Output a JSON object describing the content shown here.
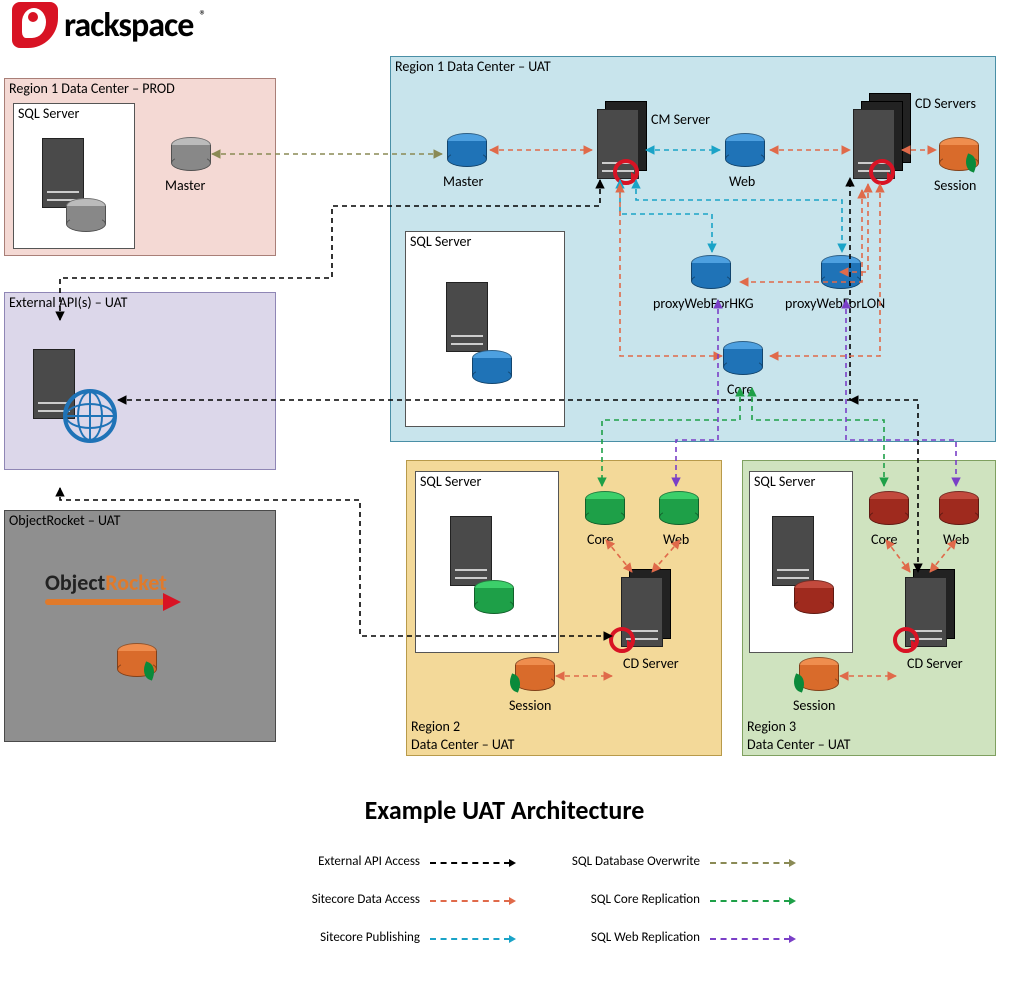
{
  "brand": "rackspace",
  "regions": {
    "prod": {
      "title": "Region 1 Data Center – PROD"
    },
    "uat1": {
      "title": "Region 1 Data Center – UAT"
    },
    "ext": {
      "title": "External API(s) – UAT"
    },
    "orock": {
      "title": "ObjectRocket – UAT",
      "brand_a": "Object",
      "brand_b": "Rocket"
    },
    "uat2": {
      "title_a": "Region 2",
      "title_b": "Data Center – UAT"
    },
    "uat3": {
      "title_a": "Region 3",
      "title_b": "Data Center – UAT"
    }
  },
  "sql_label": "SQL Server",
  "labels": {
    "master_prod": "Master",
    "master_uat": "Master",
    "web": "Web",
    "cm": "CM Server",
    "cd": "CD Servers",
    "cd_single": "CD Server",
    "session": "Session",
    "proxy_hkg": "proxyWebForHKG",
    "proxy_lon": "proxyWebForLON",
    "core": "Core"
  },
  "title": "Example UAT Architecture",
  "legend": [
    {
      "name": "External API Access",
      "color": "#000000"
    },
    {
      "name": "Sitecore Data Access",
      "color": "#e06a4a"
    },
    {
      "name": "Sitecore Publishing",
      "color": "#1aa3c7"
    },
    {
      "name": "SQL Database Overwrite",
      "color": "#8a8a55"
    },
    {
      "name": "SQL Core Replication",
      "color": "#1ea048"
    },
    {
      "name": "SQL Web Replication",
      "color": "#7a3fc7"
    }
  ]
}
